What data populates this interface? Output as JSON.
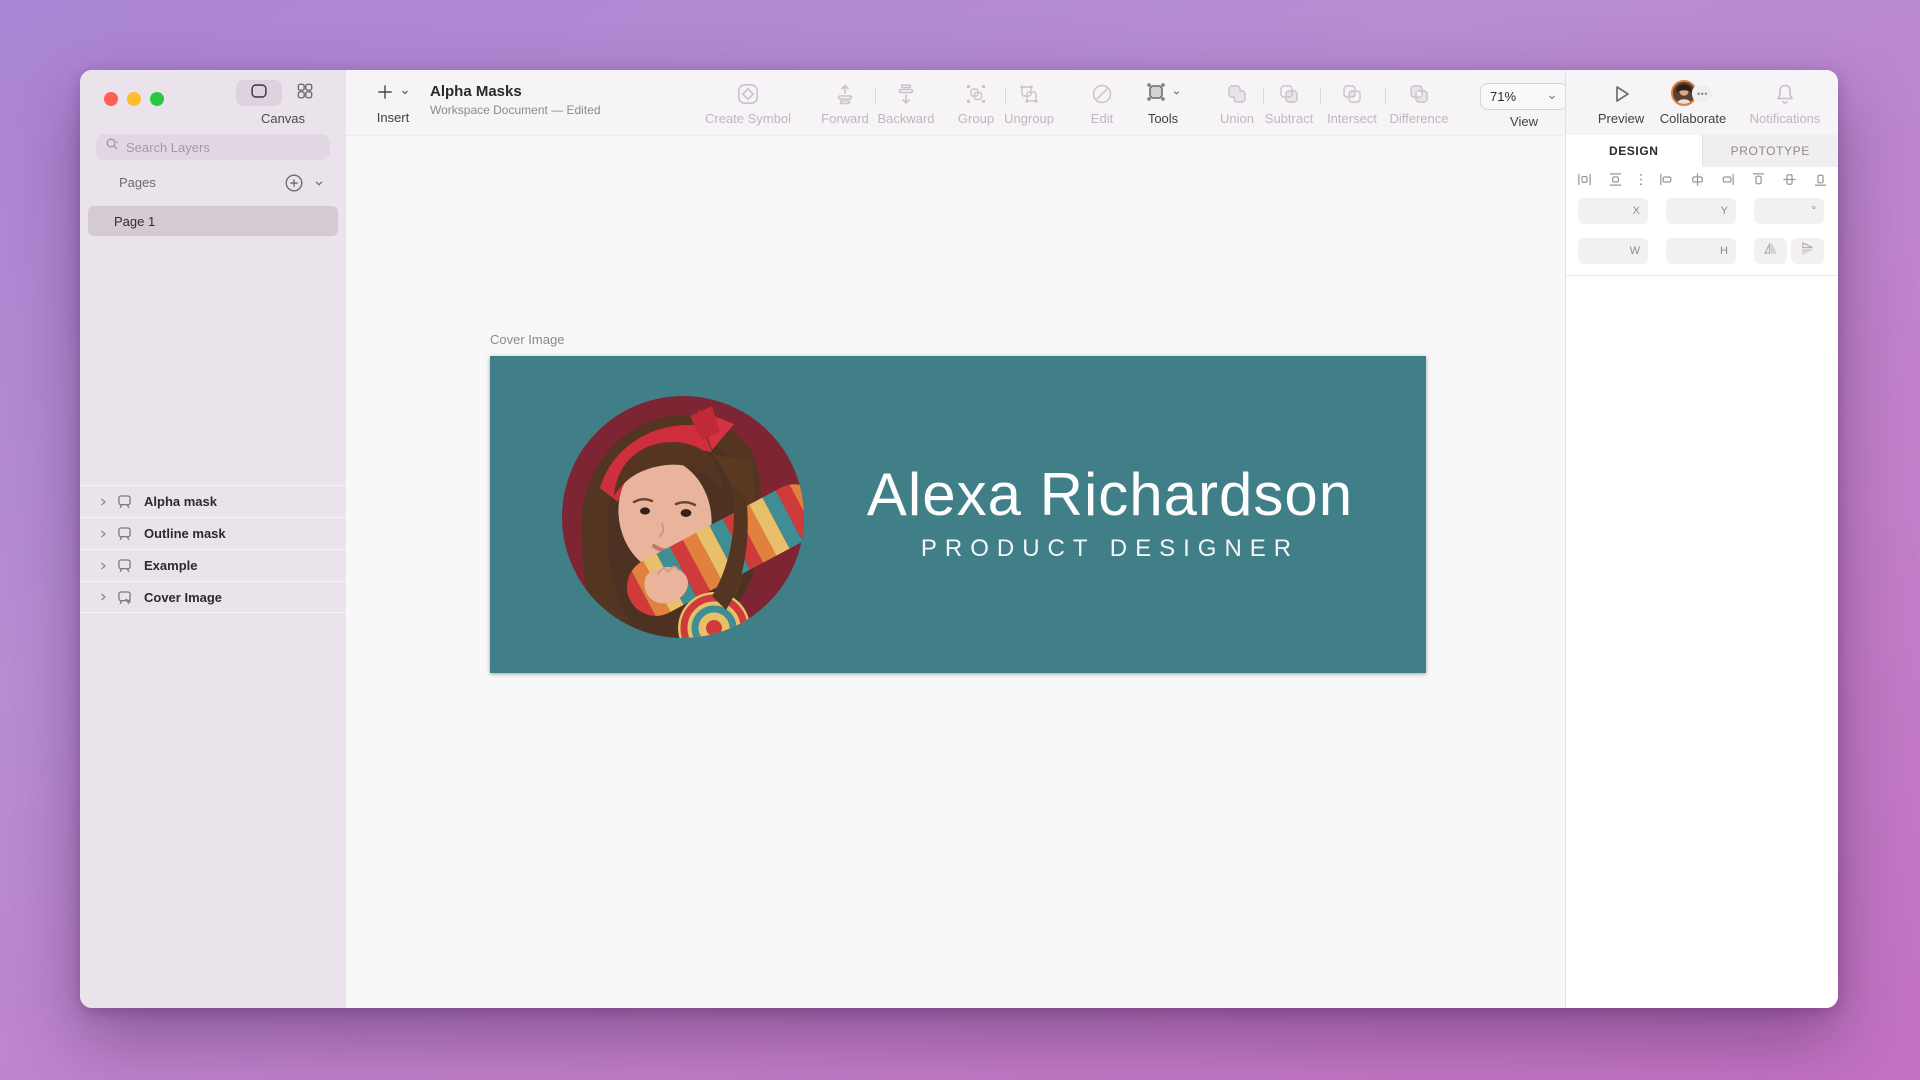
{
  "titlebar": {
    "view_toggle_label": "Canvas"
  },
  "sidebar": {
    "search_placeholder": "Search Layers",
    "pages_header": "Pages",
    "page_items": [
      {
        "name": "Page 1",
        "selected": true
      }
    ],
    "layers": [
      {
        "name": "Alpha mask",
        "icon": "artboard"
      },
      {
        "name": "Outline mask",
        "icon": "artboard"
      },
      {
        "name": "Example",
        "icon": "artboard"
      },
      {
        "name": "Cover Image",
        "icon": "artboard-edited"
      }
    ]
  },
  "toolbar": {
    "insert_label": "Insert",
    "title": "Alpha Masks",
    "subtitle": "Workspace Document — Edited",
    "create_symbol_label": "Create Symbol",
    "forward_label": "Forward",
    "backward_label": "Backward",
    "group_label": "Group",
    "ungroup_label": "Ungroup",
    "edit_label": "Edit",
    "tools_label": "Tools",
    "union_label": "Union",
    "subtract_label": "Subtract",
    "intersect_label": "Intersect",
    "difference_label": "Difference",
    "zoom_value": "71%",
    "view_label": "View",
    "preview_label": "Preview",
    "collaborate_label": "Collaborate",
    "collaborate_more": "•••",
    "notifications_label": "Notifications"
  },
  "inspector": {
    "tabs": {
      "design": "DESIGN",
      "prototype": "PROTOTYPE"
    },
    "fields": {
      "x": "X",
      "y": "Y",
      "rotation": "°",
      "w": "W",
      "h": "H"
    },
    "field_values": {
      "x": "",
      "y": "",
      "rotation": "",
      "w": "",
      "h": ""
    }
  },
  "canvas": {
    "artboard_label": "Cover Image",
    "cover": {
      "name": "Alexa Richardson",
      "role": "PRODUCT DESIGNER",
      "bg_color": "#417f88"
    }
  },
  "colors": {
    "artboard_teal": "#417f88",
    "collaborate_ring": "#e0813c",
    "traffic_red": "#ff5f57",
    "traffic_yellow": "#febc2e",
    "traffic_green": "#28c840"
  },
  "icons": [
    "canvas-frame",
    "components-grid",
    "search",
    "add-page",
    "chevron-down",
    "disclosure-right",
    "artboard",
    "artboard-edited",
    "plus",
    "create-symbol",
    "move-forward",
    "move-backward",
    "group",
    "ungroup",
    "edit-pen",
    "tools-transform",
    "union",
    "subtract",
    "intersect",
    "difference",
    "play",
    "avatar",
    "more-dots",
    "bell",
    "distribute-horizontal",
    "distribute-vertical",
    "align-left",
    "align-center-h",
    "align-right",
    "align-top",
    "align-middle",
    "align-bottom",
    "flip-horizontal",
    "flip-vertical"
  ]
}
